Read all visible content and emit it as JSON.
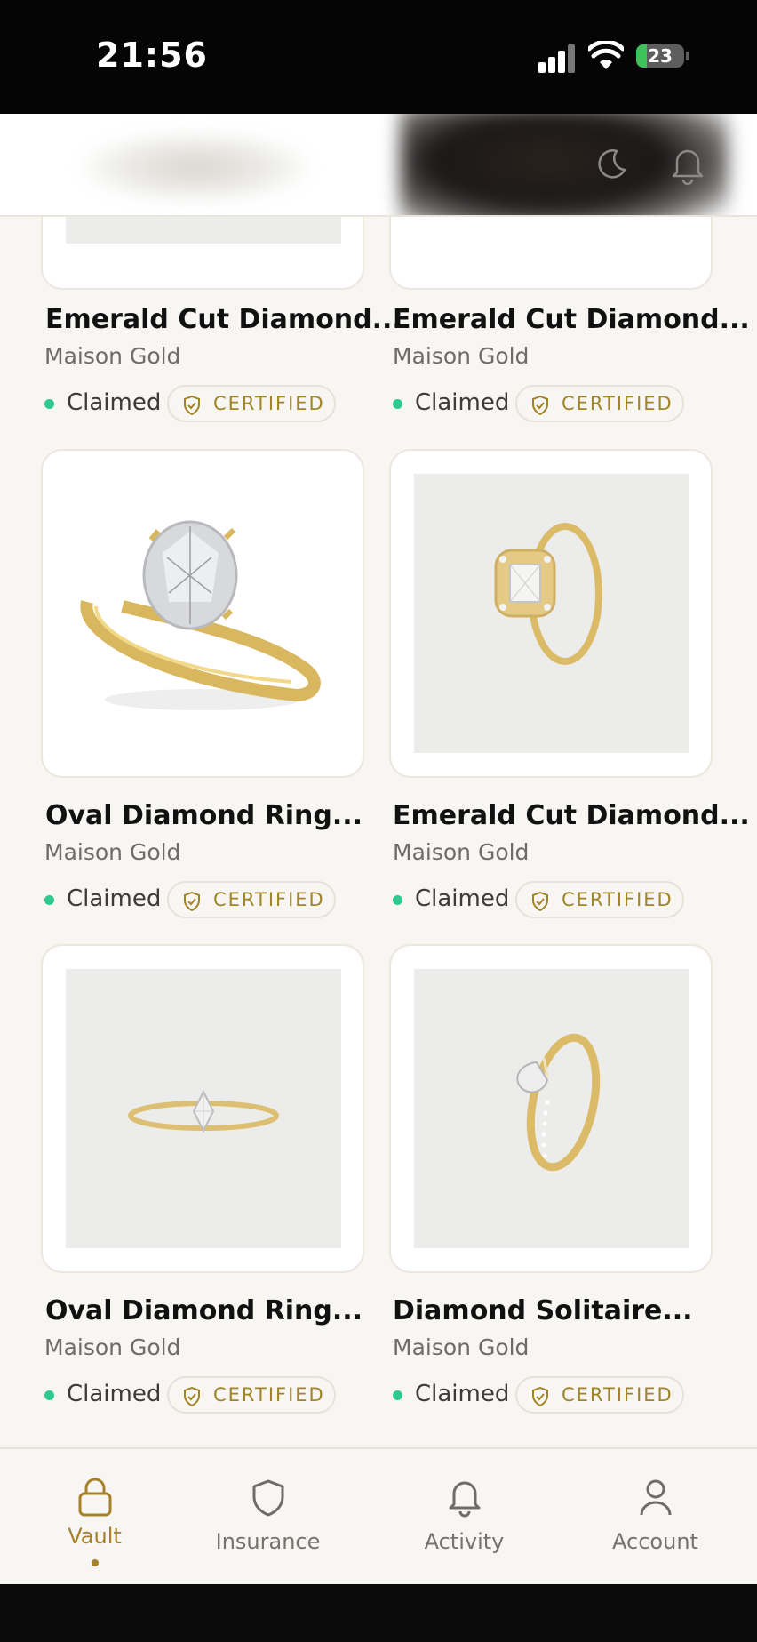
{
  "status_bar": {
    "time": "21:56",
    "battery": "23",
    "battery_level": 0.23
  },
  "header": {
    "icons": [
      "moon-icon",
      "bell-icon"
    ]
  },
  "products": [
    {
      "title": "Emerald Cut Diamond...",
      "brand": "Maison Gold",
      "status": "Claimed",
      "badge": "CERTIFIED"
    },
    {
      "title": "Emerald Cut Diamond...",
      "brand": "Maison Gold",
      "status": "Claimed",
      "badge": "CERTIFIED"
    },
    {
      "title": "Oval Diamond Ring...",
      "brand": "Maison Gold",
      "status": "Claimed",
      "badge": "CERTIFIED"
    },
    {
      "title": "Emerald Cut Diamond...",
      "brand": "Maison Gold",
      "status": "Claimed",
      "badge": "CERTIFIED"
    },
    {
      "title": "Oval Diamond Ring...",
      "brand": "Maison Gold",
      "status": "Claimed",
      "badge": "CERTIFIED"
    },
    {
      "title": "Diamond Solitaire...",
      "brand": "Maison Gold",
      "status": "Claimed",
      "badge": "CERTIFIED"
    }
  ],
  "tabs": [
    {
      "label": "Vault",
      "icon": "lock-icon",
      "active": true
    },
    {
      "label": "Insurance",
      "icon": "shield-icon",
      "active": false
    },
    {
      "label": "Activity",
      "icon": "bell-icon",
      "active": false
    },
    {
      "label": "Account",
      "icon": "user-icon",
      "active": false
    }
  ],
  "colors": {
    "accent": "#a5812b",
    "status_green": "#2ec98e",
    "background": "#f7f6f2"
  }
}
